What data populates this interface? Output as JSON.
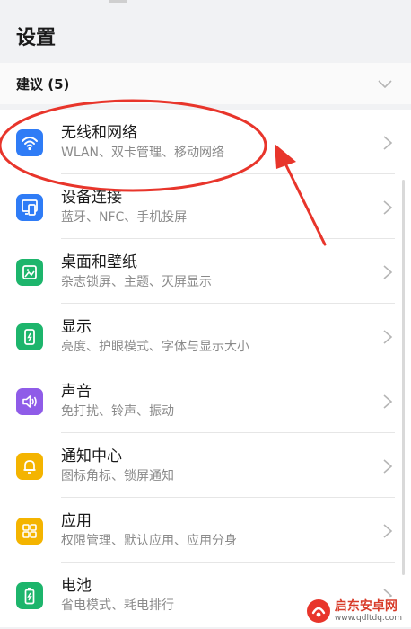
{
  "header": {
    "title": "设置"
  },
  "suggestions": {
    "label": "建议 (5)"
  },
  "items": [
    {
      "key": "wireless",
      "title": "无线和网络",
      "subtitle": "WLAN、双卡管理、移动网络",
      "icon": "wifi-icon",
      "color": "#2f7cf6"
    },
    {
      "key": "device",
      "title": "设备连接",
      "subtitle": "蓝牙、NFC、手机投屏",
      "icon": "device-connect-icon",
      "color": "#2f7cf6"
    },
    {
      "key": "desktop",
      "title": "桌面和壁纸",
      "subtitle": "杂志锁屏、主题、灭屏显示",
      "icon": "wallpaper-icon",
      "color": "#1db56c"
    },
    {
      "key": "display",
      "title": "显示",
      "subtitle": "亮度、护眼模式、字体与显示大小",
      "icon": "display-icon",
      "color": "#1db56c"
    },
    {
      "key": "sound",
      "title": "声音",
      "subtitle": "免打扰、铃声、振动",
      "icon": "speaker-icon",
      "color": "#8f5ce8"
    },
    {
      "key": "notify",
      "title": "通知中心",
      "subtitle": "图标角标、锁屏通知",
      "icon": "bell-icon",
      "color": "#f4b400"
    },
    {
      "key": "apps",
      "title": "应用",
      "subtitle": "权限管理、默认应用、应用分身",
      "icon": "apps-grid-icon",
      "color": "#f4b400"
    },
    {
      "key": "battery",
      "title": "电池",
      "subtitle": "省电模式、耗电排行",
      "icon": "battery-icon",
      "color": "#1db56c"
    }
  ],
  "watermark": {
    "name": "启东安卓网",
    "url": "www.qdltdq.com"
  },
  "colors": {
    "annotation": "#e8352b",
    "background": "#f1f2f4"
  }
}
